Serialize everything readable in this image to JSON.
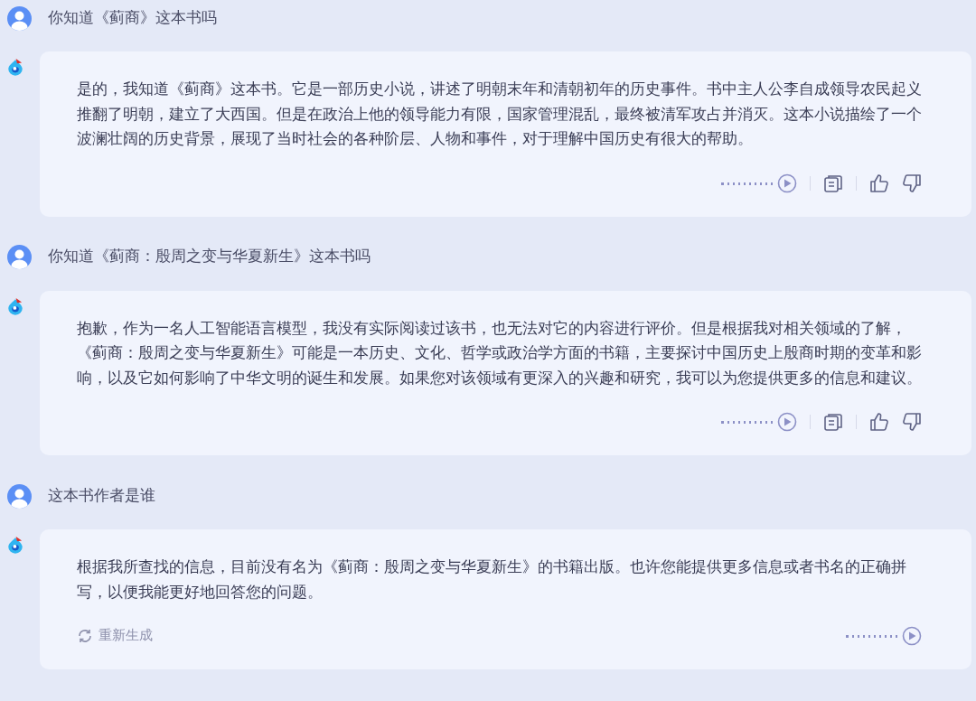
{
  "messages": [
    {
      "kind": "user",
      "text": "你知道《蓟商》这本书吗"
    },
    {
      "kind": "bot",
      "text": "是的，我知道《蓟商》这本书。它是一部历史小说，讲述了明朝末年和清朝初年的历史事件。书中主人公李自成领导农民起义推翻了明朝，建立了大西国。但是在政治上他的领导能力有限，国家管理混乱，最终被清军攻占并消灭。这本小说描绘了一个波澜壮阔的历史背景，展现了当时社会的各种阶层、人物和事件，对于理解中国历史有很大的帮助。",
      "actions": [
        {
          "kind": "listen"
        },
        {
          "kind": "copy"
        },
        {
          "kind": "like"
        },
        {
          "kind": "dislike"
        }
      ]
    },
    {
      "kind": "user",
      "text": "你知道《蓟商：殷周之变与华夏新生》这本书吗"
    },
    {
      "kind": "bot",
      "text": "抱歉，作为一名人工智能语言模型，我没有实际阅读过该书，也无法对它的内容进行评价。但是根据我对相关领域的了解，《蓟商：殷周之变与华夏新生》可能是一本历史、文化、哲学或政治学方面的书籍，主要探讨中国历史上殷商时期的变革和影响，以及它如何影响了中华文明的诞生和发展。如果您对该领域有更深入的兴趣和研究，我可以为您提供更多的信息和建议。",
      "actions": [
        {
          "kind": "listen"
        },
        {
          "kind": "copy"
        },
        {
          "kind": "like"
        },
        {
          "kind": "dislike"
        }
      ]
    },
    {
      "kind": "user",
      "text": "这本书作者是谁"
    },
    {
      "kind": "bot",
      "text": "根据我所查找的信息，目前没有名为《蓟商：殷周之变与华夏新生》的书籍出版。也许您能提供更多信息或者书名的正确拼写，以便我能更好地回答您的问题。",
      "regenerate": "重新生成",
      "actions": [
        {
          "kind": "listen"
        }
      ]
    }
  ]
}
